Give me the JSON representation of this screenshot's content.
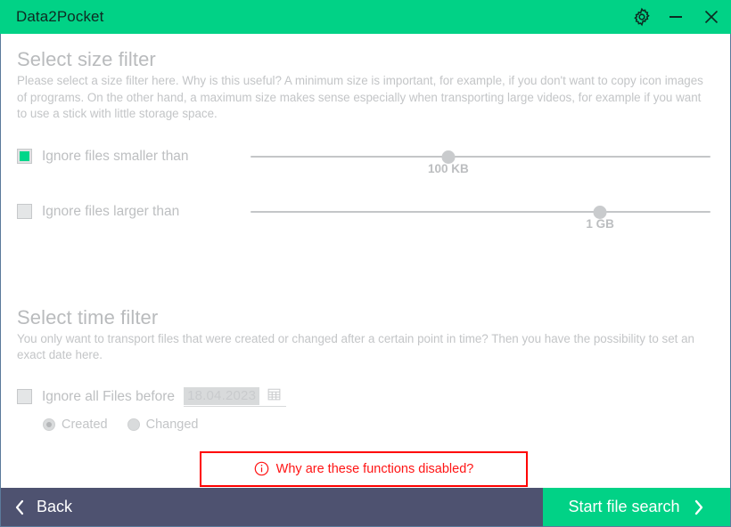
{
  "window": {
    "title": "Data2Pocket",
    "titlebar_color": "#01d286",
    "footer_color": "#4e5270",
    "controls": {
      "settings": "settings-gear",
      "minimize": "minimize",
      "close": "close"
    }
  },
  "size_filter": {
    "title": "Select size filter",
    "description": "Please select a size filter here. Why is this useful? A minimum size is important, for example, if you don't want to copy icon images of programs. On the other hand, a maximum size makes sense especially when transporting large videos, for example if you want to use a stick with little storage space.",
    "rows": [
      {
        "label": "Ignore files smaller than",
        "checked": true,
        "value": "100 KB",
        "handle_percent": 43
      },
      {
        "label": "Ignore files larger than",
        "checked": false,
        "value": "1 GB",
        "handle_percent": 76
      }
    ]
  },
  "time_filter": {
    "title": "Select time filter",
    "description": "You only want to transport files that were created or changed after a certain point in time? Then you have the possibility to set an exact date here.",
    "date_row": {
      "label": "Ignore all Files before",
      "checked": false,
      "date_value": "18.04.2023",
      "calendar_icon": "calendar-icon"
    },
    "radios": [
      {
        "label": "Created",
        "selected": true
      },
      {
        "label": "Changed",
        "selected": false
      }
    ]
  },
  "notice": {
    "text": "Why are these functions disabled?",
    "icon": "info-circle-icon",
    "color": "#ff0000"
  },
  "footer": {
    "back_label": "Back",
    "start_label": "Start file search",
    "start_color": "#01d286"
  }
}
